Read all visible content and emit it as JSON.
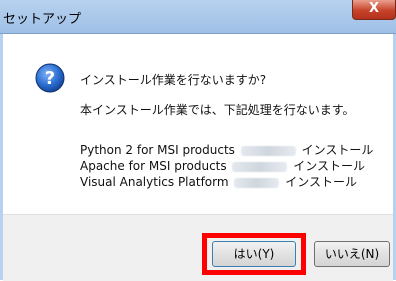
{
  "window": {
    "title": "セットアップ",
    "close_label": "X"
  },
  "dialog": {
    "icon": "question-icon",
    "question": "インストール作業を行ないますか?",
    "description": "本インストール作業では、下記処理を行ないます。",
    "items": [
      {
        "name": "Python 2 for MSI products",
        "action": "インストール"
      },
      {
        "name": "Apache for MSI products",
        "action": "インストール"
      },
      {
        "name": "Visual Analytics Platform",
        "action": "インストール"
      }
    ]
  },
  "buttons": {
    "yes_label": "はい(Y)",
    "no_label": "いいえ(N)"
  },
  "colors": {
    "highlight": "#ff0000",
    "titlebar": "#b7d1ee",
    "icon": "#1f5fc4"
  }
}
